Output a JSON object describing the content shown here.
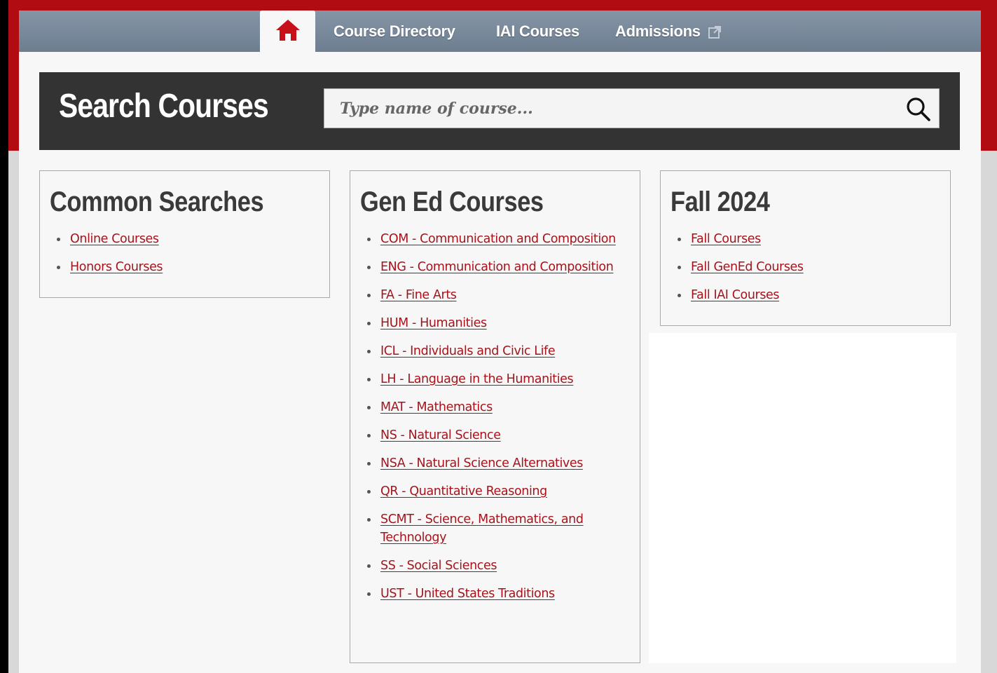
{
  "nav": {
    "home_icon": "home-icon",
    "items": [
      {
        "label": "Course Directory"
      },
      {
        "label": "IAI Courses"
      },
      {
        "label": "Admissions",
        "icon": "external-link-icon"
      }
    ]
  },
  "search": {
    "title": "Search Courses",
    "placeholder": "Type name of course...",
    "value": "",
    "icon": "search-icon"
  },
  "common_searches": {
    "title": "Common Searches",
    "links": [
      "Online Courses",
      "Honors Courses"
    ]
  },
  "gen_ed": {
    "title": "Gen Ed Courses",
    "links": [
      "COM - Communication and Composition",
      "ENG - Communication and Composition",
      "FA - Fine Arts",
      "HUM - Humanities",
      "ICL - Individuals and Civic Life",
      "LH - Language in the Humanities",
      "MAT - Mathematics",
      "NS - Natural Science",
      "NSA - Natural Science Alternatives",
      "QR - Quantitative Reasoning",
      "SCMT - Science, Mathematics, and Technology",
      "SS - Social Sciences",
      "UST - United States Traditions"
    ]
  },
  "fall": {
    "title": "Fall 2024",
    "links": [
      "Fall Courses",
      "Fall GenEd Courses",
      "Fall IAI Courses"
    ]
  },
  "colors": {
    "brand_red": "#b10c12",
    "link_red": "#a8121a",
    "nav_slate": "#7a8a9c",
    "search_bar": "#333333"
  }
}
